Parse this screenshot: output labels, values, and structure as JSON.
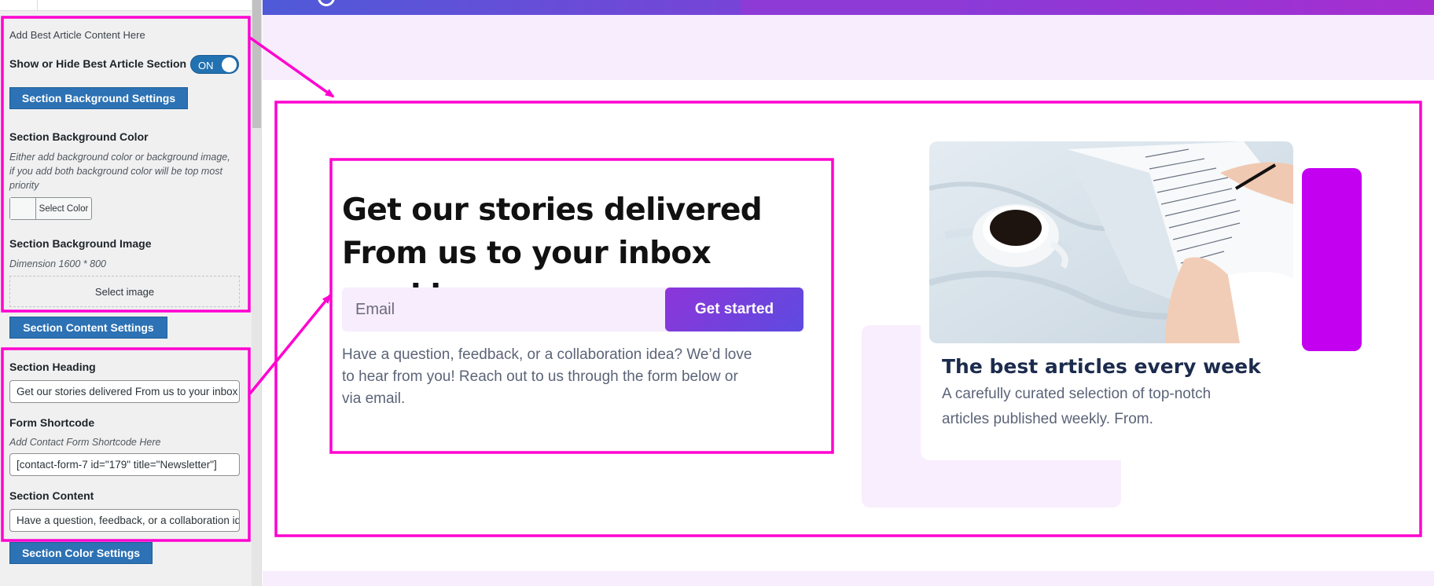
{
  "panel": {
    "intro": "Add Best Article Content Here",
    "toggle_label": "Show or Hide Best Article Section",
    "toggle_state": "ON",
    "bg_settings_button": "Section Background Settings",
    "bg_color_label": "Section Background Color",
    "bg_color_hint": [
      "Either add background color or background image,",
      "if you add both background color will be top most",
      "priority"
    ],
    "select_color": "Select Color",
    "bg_image_label": "Section Background Image",
    "bg_image_hint": "Dimension 1600 * 800",
    "select_image": "Select image",
    "content_settings_button": "Section Content Settings",
    "heading_label": "Section Heading",
    "heading_value": "Get our stories delivered From us to your inbox weekly.",
    "form_label": "Form Shortcode",
    "form_hint": "Add Contact Form Shortcode Here",
    "form_value": "[contact-form-7 id=\"179\" title=\"Newsletter\"]",
    "content_label": "Section Content",
    "content_value": "Have a question, feedback, or a collaboration idea? We’d love to hear from you! Reach out to us through the form below or via email.",
    "color_settings_button": "Section Color Settings"
  },
  "preview": {
    "heading_line1": "Get our stories delivered",
    "heading_line2": "From us to your inbox weekly.",
    "email_placeholder": "Email",
    "cta": "Get started",
    "description_lines": [
      "Have a question, feedback, or a collaboration idea? We’d love",
      "to hear from you! Reach out to us through the form below or",
      "via email."
    ],
    "card_title": "The best articles every week",
    "card_text_lines": [
      "A carefully curated selection of top-notch",
      "articles published weekly. From."
    ]
  },
  "colors": {
    "annotation": "#ff00d0",
    "wp_button": "#2c72b4",
    "accent_purple": "#c400f0",
    "lavender": "#f7edfd"
  },
  "icons": [
    "toggle-switch-icon",
    "coffee-photo",
    "annotation-arrow"
  ]
}
